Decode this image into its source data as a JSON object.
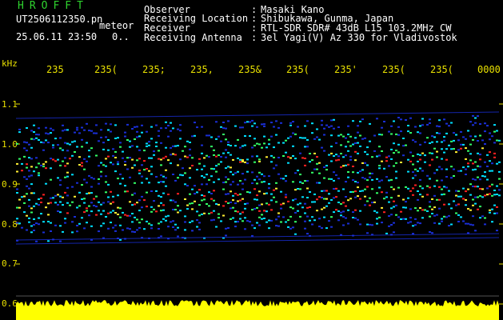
{
  "header": {
    "brand": "HROFFT",
    "filename": "UT2506112350.pn",
    "tag": "meteor",
    "datetime": "25.06.11 23:50",
    "counter": "0..",
    "fields": [
      {
        "label": "Observer",
        "value": "Masaki Kano"
      },
      {
        "label": "Receiving Location",
        "value": "Shibukawa, Gunma, Japan"
      },
      {
        "label": "Receiver",
        "value": "RTL-SDR SDR# 43dB L15 103.2MHz CW"
      },
      {
        "label": "Receiving Antenna",
        "value": "3el Yagi(V) Az 330 for Vladivostok"
      }
    ]
  },
  "axis": {
    "unit": "kHz",
    "y_ticks": [
      "1.1",
      "1.0",
      "0.9",
      "0.8",
      "0.7",
      "0.6"
    ],
    "x_ticks": [
      "235",
      "235(",
      "235;",
      "235,",
      "235&",
      "235(",
      "235'",
      "235(",
      "235(",
      "0000"
    ]
  },
  "colors": {
    "background": "#000000",
    "axis": "#e8e000",
    "brand": "#2fd42f",
    "noise_floor": "#ffff00",
    "signal_low": "#1a2fd6",
    "signal_mid": "#00e0ff",
    "signal_high": "#ff2020"
  }
}
